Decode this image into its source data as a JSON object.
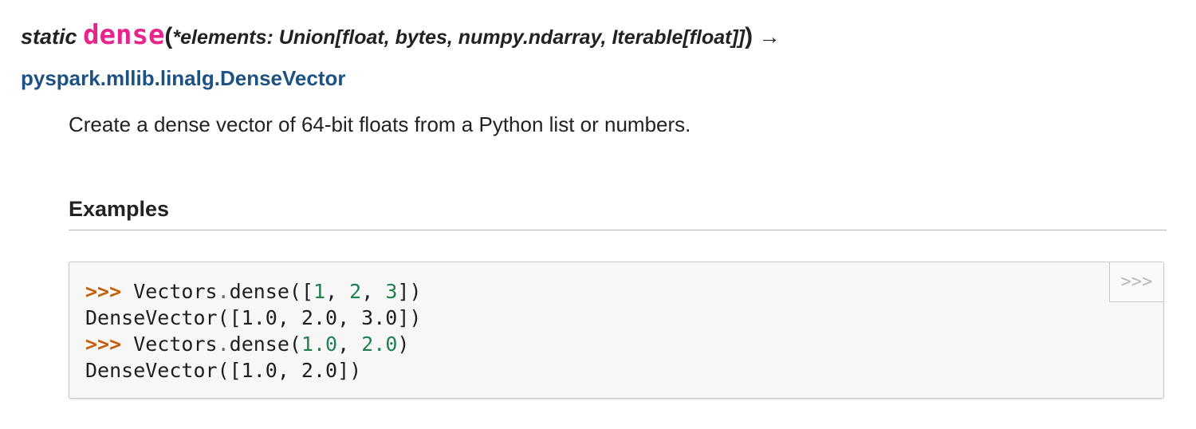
{
  "signature": {
    "prefix": "static",
    "name": "dense",
    "open_paren": "(",
    "params": "*elements: Union[float, bytes, numpy.ndarray, Iterable[float]]",
    "close_paren": ")",
    "arrow": "→",
    "return_type": "pyspark.mllib.linalg.DenseVector"
  },
  "description": "Create a dense vector of 64-bit floats from a Python list or numbers.",
  "examples": {
    "heading": "Examples",
    "copy_button_label": ">>>",
    "lines": [
      {
        "prompt": ">>>",
        "pre": " Vectors",
        "dot": ".",
        "fn": "dense([",
        "n1": "1",
        "s1": ", ",
        "n2": "2",
        "s2": ", ",
        "n3": "3",
        "post": "])"
      },
      {
        "output": "DenseVector([1.0, 2.0, 3.0])"
      },
      {
        "prompt": ">>>",
        "pre": " Vectors",
        "dot": ".",
        "fn": "dense(",
        "n1": "1.0",
        "s1": ", ",
        "n2": "2.0",
        "post": ")"
      },
      {
        "output": "DenseVector([1.0, 2.0])"
      }
    ]
  },
  "colors": {
    "function_name": "#e6248a",
    "link": "#1c5283",
    "prompt": "#c65d09",
    "number": "#208050"
  }
}
